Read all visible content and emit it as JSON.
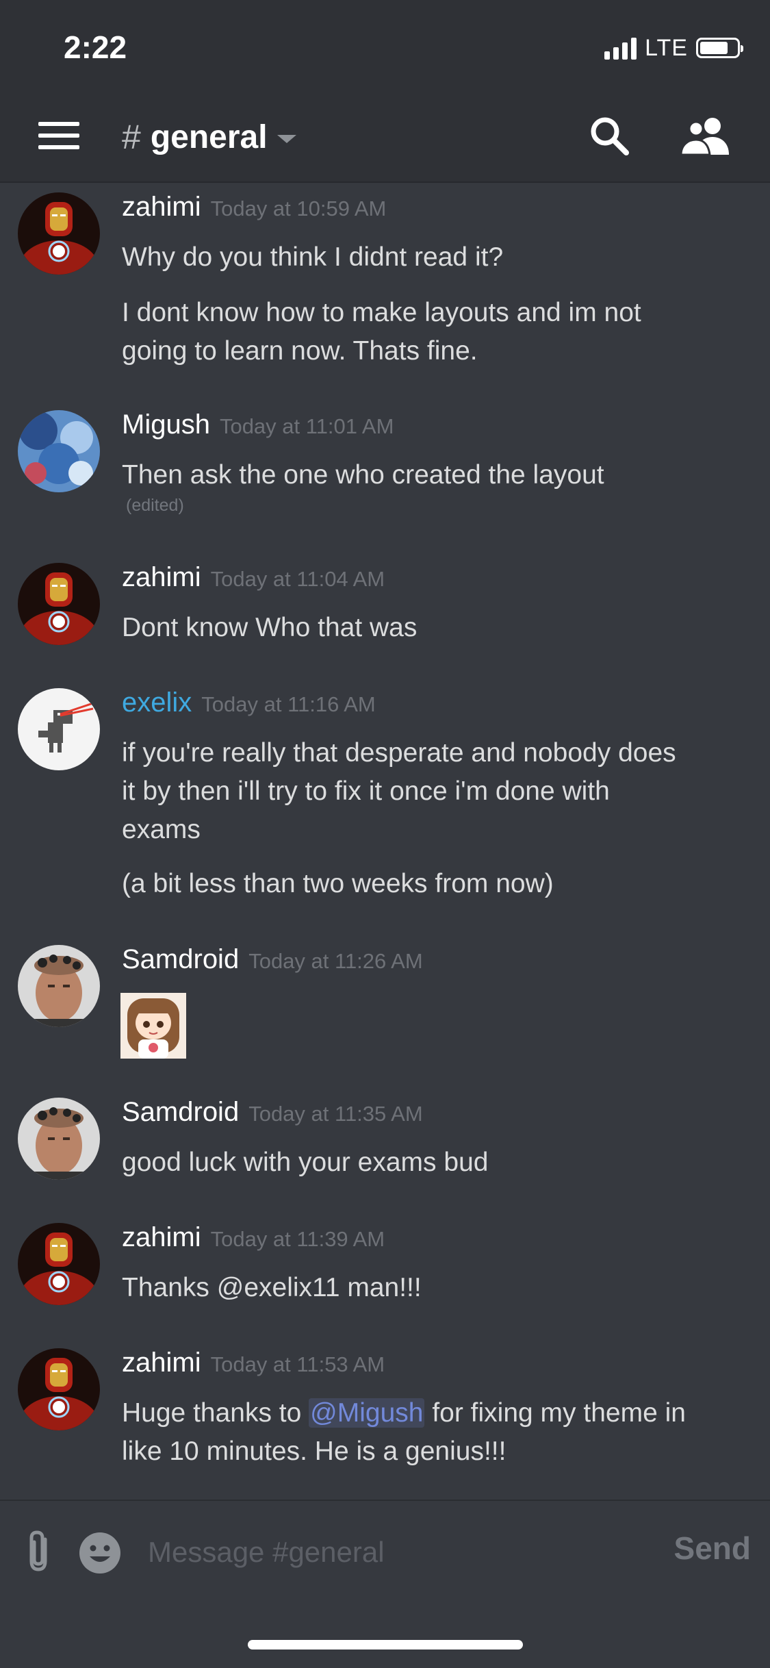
{
  "status": {
    "time": "2:22",
    "network": "LTE"
  },
  "header": {
    "channel_hash": "#",
    "channel_name": "general"
  },
  "messages": [
    {
      "user": "zahimi",
      "time": "Today at 10:59 AM",
      "lines": [
        "Why do you think I didnt read it?",
        "I dont know how to make layouts and im not",
        "going to learn now. Thats fine."
      ]
    },
    {
      "user": "Migush",
      "time": "Today at 11:01 AM",
      "lines": [
        "Then ask the one who created the layout"
      ],
      "edited": "(edited)"
    },
    {
      "user": "zahimi",
      "time": "Today at 11:04 AM",
      "lines": [
        "Dont know Who that was"
      ]
    },
    {
      "user": "exelix",
      "time": "Today at 11:16 AM",
      "lines": [
        "if you're really that desperate and nobody does",
        "it by then i'll try to fix it once i'm done with",
        "exams",
        "(a bit less than two weeks from now)"
      ]
    },
    {
      "user": "Samdroid",
      "time": "Today at 11:26 AM",
      "sticker": "anime-girl-sticker"
    },
    {
      "user": "Samdroid",
      "time": "Today at 11:35 AM",
      "lines": [
        "good luck with your exams bud"
      ]
    },
    {
      "user": "zahimi",
      "time": "Today at 11:39 AM",
      "lines": [
        "Thanks @exelix11 man!!!"
      ]
    },
    {
      "user": "zahimi",
      "time": "Today at 11:53 AM",
      "line1_pre": "Huge thanks to ",
      "mention": "@Migush",
      "line1_post": " for fixing my theme in",
      "line2": "like 10 minutes. He is a genius!!!"
    }
  ],
  "composer": {
    "placeholder": "Message #general",
    "send_label": "Send"
  },
  "colors": {
    "background": "#36393f",
    "header": "#2f3136",
    "mention": "#7289da",
    "exelix_name": "#3fa9e0"
  }
}
